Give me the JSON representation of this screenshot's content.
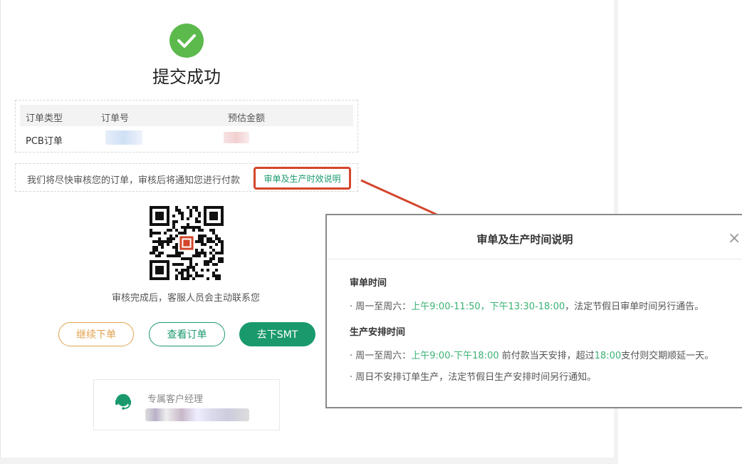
{
  "success": {
    "title": "提交成功"
  },
  "order_table": {
    "headers": [
      "订单类型",
      "订单号",
      "预估金额"
    ],
    "row": {
      "type": "PCB订单"
    }
  },
  "notice": {
    "text": "我们将尽快审核您的订单，审核后将通知您进行付款",
    "link": "审单及生产时效说明"
  },
  "contact_text": "审核完成后，客服人员会主动联系您",
  "buttons": {
    "continue": "继续下单",
    "view": "查看订单",
    "smt": "去下SMT"
  },
  "manager": {
    "label": "专属客户经理"
  },
  "modal": {
    "title": "审单及生产时间说明",
    "close": "×",
    "review": {
      "title": "审单时间",
      "l_prefix": "· 周一至周六：",
      "l_hl": "上午9:00-11:50，下午13:30-18:00",
      "l_suffix": "，法定节假日审单时间另行通告。"
    },
    "production": {
      "title": "生产安排时间",
      "l1_prefix": "· 周一至周六：",
      "l1_hl1": "上午9:00-下午18:00",
      "l1_mid": " 前付款当天安排，超过",
      "l1_hl2": "18:00",
      "l1_suffix": "支付则交期顺延一天。",
      "l2": "· 周日不安排订单生产，法定节假日生产安排时间另行通知。"
    }
  },
  "colors": {
    "green": "#1a9a6c",
    "success": "#5cb94c",
    "orange": "#e2a24e",
    "highlight": "#d3462c"
  }
}
